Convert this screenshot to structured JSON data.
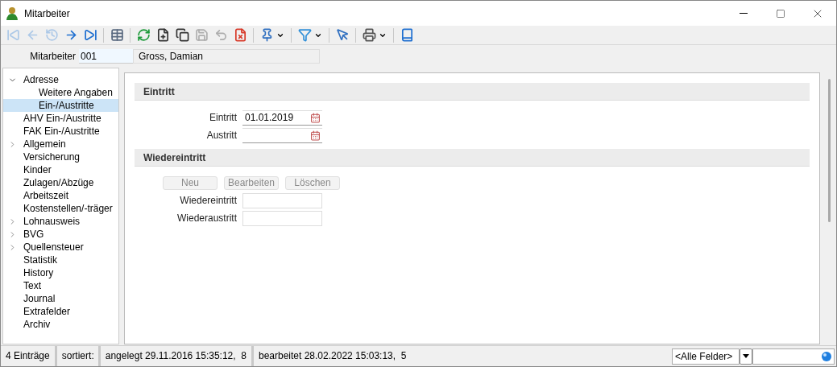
{
  "window": {
    "title": "Mitarbeiter"
  },
  "toolbar": [
    {
      "kind": "first",
      "disabled": true
    },
    {
      "kind": "prev",
      "disabled": true
    },
    {
      "kind": "history",
      "disabled": true
    },
    {
      "kind": "next",
      "disabled": false
    },
    {
      "kind": "last",
      "disabled": false
    },
    {
      "kind": "sep"
    },
    {
      "kind": "grid",
      "disabled": false
    },
    {
      "kind": "sep"
    },
    {
      "kind": "refresh",
      "disabled": false
    },
    {
      "kind": "new",
      "disabled": false
    },
    {
      "kind": "copy",
      "disabled": false
    },
    {
      "kind": "save",
      "disabled": true
    },
    {
      "kind": "undo",
      "disabled": true
    },
    {
      "kind": "delete",
      "disabled": false
    },
    {
      "kind": "sep"
    },
    {
      "kind": "pin",
      "disabled": false
    },
    {
      "kind": "drop"
    },
    {
      "kind": "sep"
    },
    {
      "kind": "filter",
      "disabled": false
    },
    {
      "kind": "drop"
    },
    {
      "kind": "sep"
    },
    {
      "kind": "select",
      "disabled": false
    },
    {
      "kind": "sep"
    },
    {
      "kind": "print",
      "disabled": false
    },
    {
      "kind": "drop"
    },
    {
      "kind": "sep"
    },
    {
      "kind": "book",
      "disabled": false
    }
  ],
  "header": {
    "label": "Mitarbeiter",
    "number": "001",
    "name": "Gross, Damian"
  },
  "tree": [
    {
      "label": "Adresse",
      "expanded": true,
      "selected": false,
      "children": [
        {
          "label": "Weitere Angaben",
          "selected": false
        },
        {
          "label": "Ein-/Austritte",
          "selected": true
        }
      ]
    },
    {
      "label": "AHV Ein-/Austritte",
      "selected": false
    },
    {
      "label": "FAK Ein-/Austritte",
      "selected": false
    },
    {
      "label": "Allgemein",
      "expanded": false,
      "selected": false
    },
    {
      "label": "Versicherung",
      "selected": false
    },
    {
      "label": "Kinder",
      "selected": false
    },
    {
      "label": "Zulagen/Abzüge",
      "selected": false
    },
    {
      "label": "Arbeitszeit",
      "selected": false
    },
    {
      "label": "Kostenstellen/-träger",
      "selected": false
    },
    {
      "label": "Lohnausweis",
      "expanded": false,
      "selected": false
    },
    {
      "label": "BVG",
      "expanded": false,
      "selected": false
    },
    {
      "label": "Quellensteuer",
      "expanded": false,
      "selected": false
    },
    {
      "label": "Statistik",
      "selected": false
    },
    {
      "label": "History",
      "selected": false
    },
    {
      "label": "Text",
      "selected": false
    },
    {
      "label": "Journal",
      "selected": false
    },
    {
      "label": "Extrafelder",
      "selected": false
    },
    {
      "label": "Archiv",
      "selected": false
    }
  ],
  "sections": [
    {
      "title": "Eintritt",
      "fields": [
        {
          "label": "Eintritt",
          "value": "01.01.2019",
          "kind": "date"
        },
        {
          "label": "Austritt",
          "kind": "date"
        }
      ]
    },
    {
      "title": "Wiedereintritt",
      "buttons": [
        {
          "label": "Neu",
          "disabled": true
        },
        {
          "label": "Bearbeiten",
          "disabled": true
        },
        {
          "label": "Löschen",
          "disabled": true
        }
      ],
      "fields": [
        {
          "label": "Wiedereintritt",
          "kind": "text"
        },
        {
          "label": "Wiederaustritt",
          "kind": "text"
        }
      ]
    }
  ],
  "status_bar": {
    "count": "4 Einträge",
    "sorted": "sortiert:",
    "created": "angelegt 29.11.2016 15:35:12,  8",
    "edited": "bearbeitet 28.02.2022 15:03:13,  5",
    "field_select": "<Alle Felder>"
  }
}
